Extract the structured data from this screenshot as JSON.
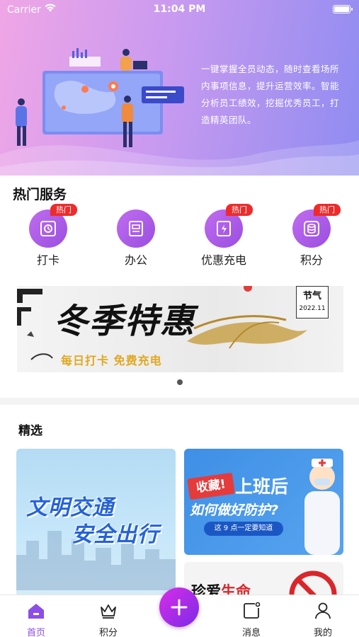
{
  "status_bar": {
    "carrier": "Carrier",
    "time": "11:04 PM"
  },
  "hero": {
    "description": "一键掌握全员动态，随时查看场所内事项信息，提升运营效率。智能分析员工绩效，挖掘优秀员工，打造精英团队。"
  },
  "hot_services": {
    "title": "热门服务",
    "items": [
      {
        "label": "打卡",
        "badge": "热门",
        "icon": "punch-card-icon"
      },
      {
        "label": "办公",
        "badge": "",
        "icon": "office-icon"
      },
      {
        "label": "优惠充电",
        "badge": "热门",
        "icon": "charging-icon"
      },
      {
        "label": "积分",
        "badge": "热门",
        "icon": "points-icon"
      }
    ]
  },
  "banner": {
    "title": "冬季特惠",
    "subtitle": "每日打卡 免费充电",
    "tag_title": "节气",
    "tag_date": "2022.11"
  },
  "featured": {
    "title": "精选",
    "card_left": {
      "line1": "文明交通",
      "line2": "安全出行"
    },
    "card_right_top": {
      "stamp": "收藏!",
      "headline": "上班后",
      "subline": "如何做好防护?",
      "pill": "这 9 点一定要知道"
    },
    "card_right_bottom": {
      "text_a": "珍爱",
      "text_b": "生命"
    }
  },
  "tabbar": {
    "items": [
      {
        "label": "首页",
        "icon": "home-icon",
        "active": true
      },
      {
        "label": "积分",
        "icon": "crown-icon",
        "active": false
      },
      {
        "label": "消息",
        "icon": "message-icon",
        "active": false
      },
      {
        "label": "我的",
        "icon": "user-icon",
        "active": false
      }
    ]
  },
  "colors": {
    "accent": "#8c4de8",
    "badge": "#ee2b2b",
    "plus_start": "#d92de9",
    "plus_end": "#7b2be6"
  }
}
